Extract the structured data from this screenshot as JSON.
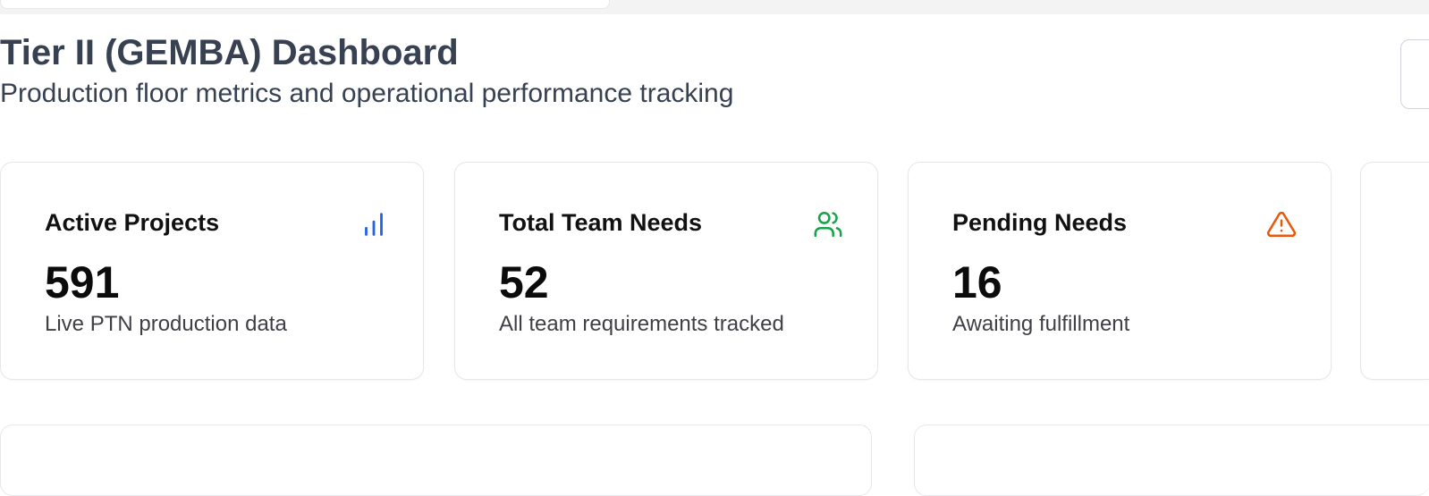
{
  "header": {
    "title": "Tier II (GEMBA) Dashboard",
    "subtitle": "Production floor metrics and operational performance tracking"
  },
  "colors": {
    "blue": "#2563eb",
    "green": "#16a34a",
    "orange": "#ea580c"
  },
  "cards": [
    {
      "title": "Active Projects",
      "value": "591",
      "description": "Live PTN production data",
      "icon": "bar-chart-icon"
    },
    {
      "title": "Total Team Needs",
      "value": "52",
      "description": "All team requirements tracked",
      "icon": "users-icon"
    },
    {
      "title": "Pending Needs",
      "value": "16",
      "description": "Awaiting fulfillment",
      "icon": "warning-triangle-icon"
    }
  ]
}
